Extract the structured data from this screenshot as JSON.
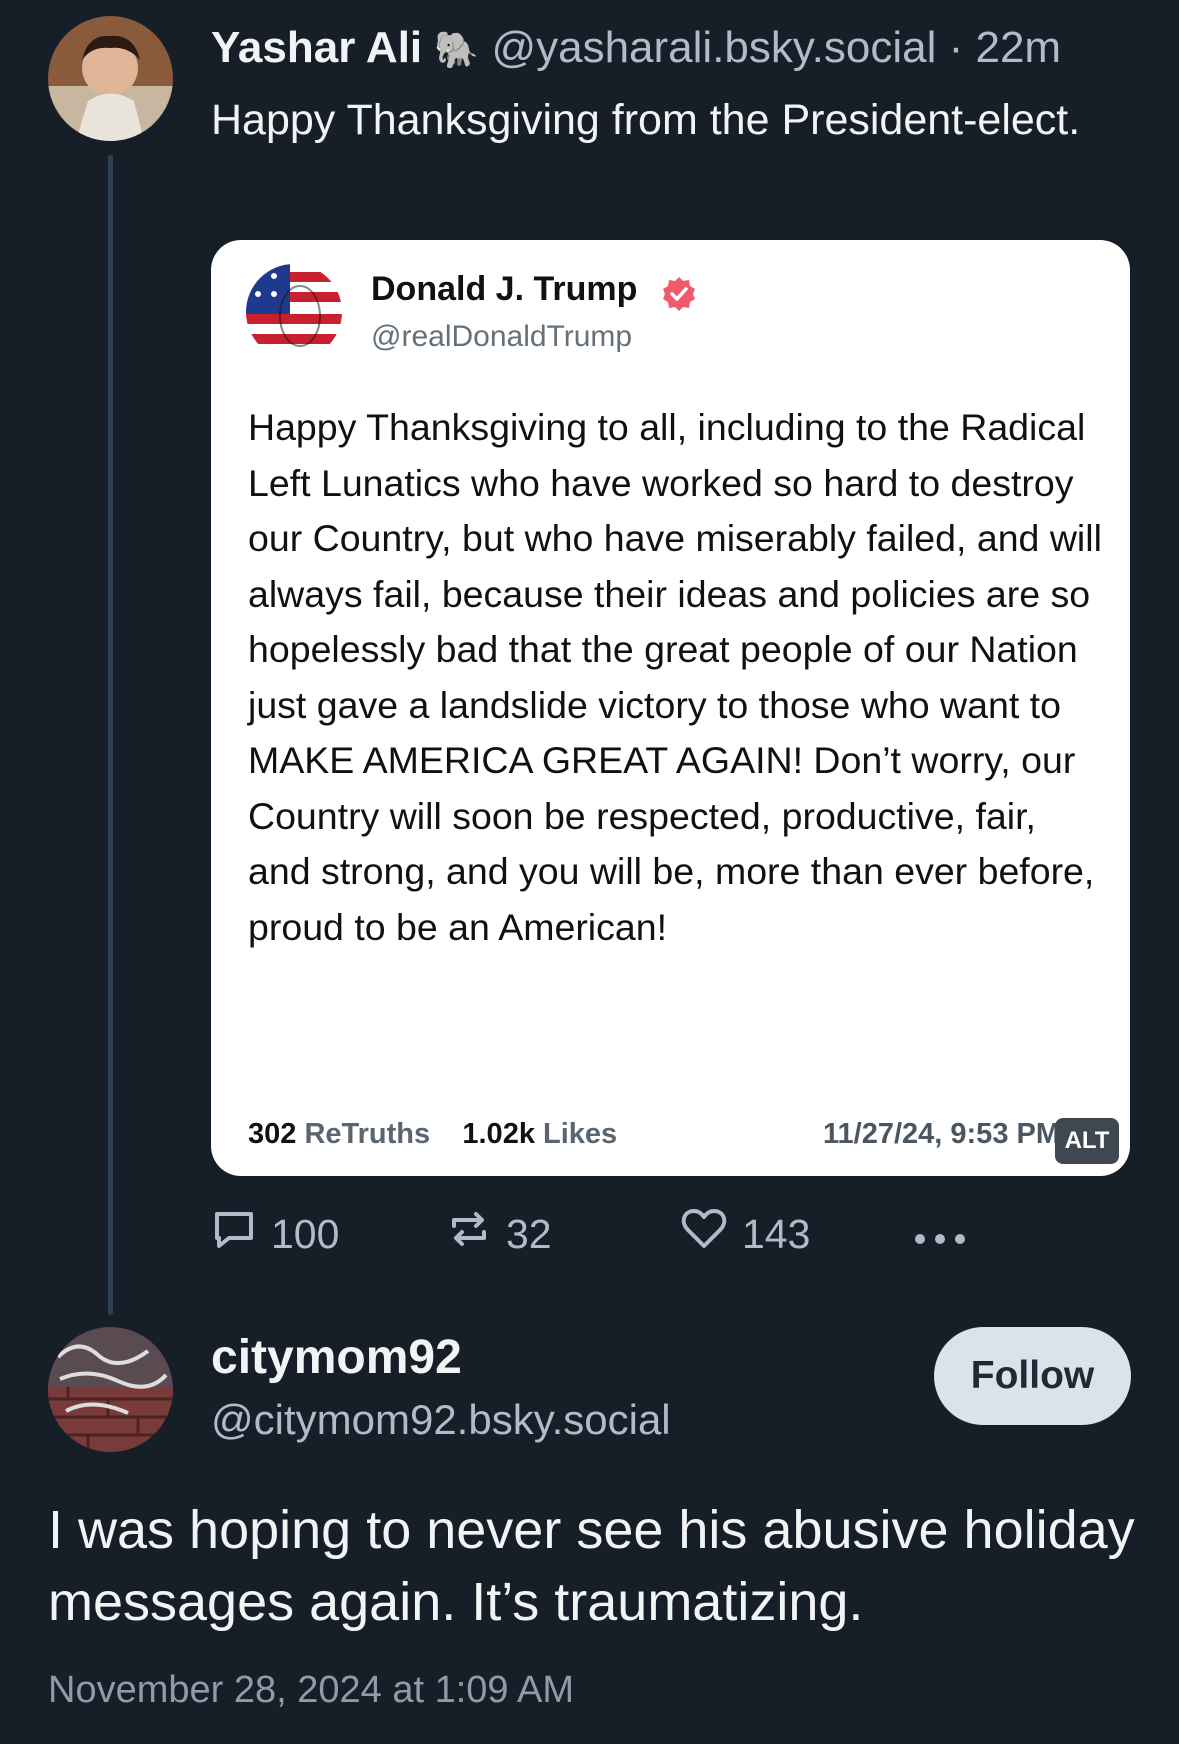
{
  "original_post": {
    "author_name": "Yashar Ali",
    "author_emoji": "🐘",
    "handle": "@yasharali.bsky.social",
    "time": "· 22m",
    "text": "Happy Thanksgiving from the President-elect.",
    "embed": {
      "author_name": "Donald J. Trump",
      "handle": "@realDonaldTrump",
      "text": "Happy Thanksgiving to all, including to the Radical Left Lunatics who have worked so hard to destroy our Country, but who have miserably failed, and will always fail, because their ideas and policies are so hopelessly bad that the great people of our Nation just gave a landslide victory to those who want to MAKE AMERICA GREAT AGAIN! Don’t worry, our Country will soon be respected, productive, fair, and strong, and you will be, more than ever before, proud to be an American!",
      "retruths_count": "302",
      "retruths_label": "ReTruths",
      "likes_count": "1.02k",
      "likes_label": "Likes",
      "date": "11/27/24, 9:53 PM",
      "alt_label": "ALT"
    },
    "actions": {
      "replies": "100",
      "reposts": "32",
      "likes": "143"
    }
  },
  "reply_post": {
    "author_name": "citymom92",
    "handle": "@citymom92.bsky.social",
    "follow_label": "Follow",
    "text": "I was hoping to never see his abusive holiday messages again. It’s traumatizing.",
    "date": "November 28, 2024 at 1:09 AM"
  },
  "icons": [
    "reply-icon",
    "repost-icon",
    "like-icon",
    "more-icon",
    "verified-badge-icon"
  ],
  "colors": {
    "background": "#161e27",
    "muted_text": "#aebbc9",
    "follow_button": "#dbe3ea",
    "verified_badge": "#f05a6b"
  }
}
